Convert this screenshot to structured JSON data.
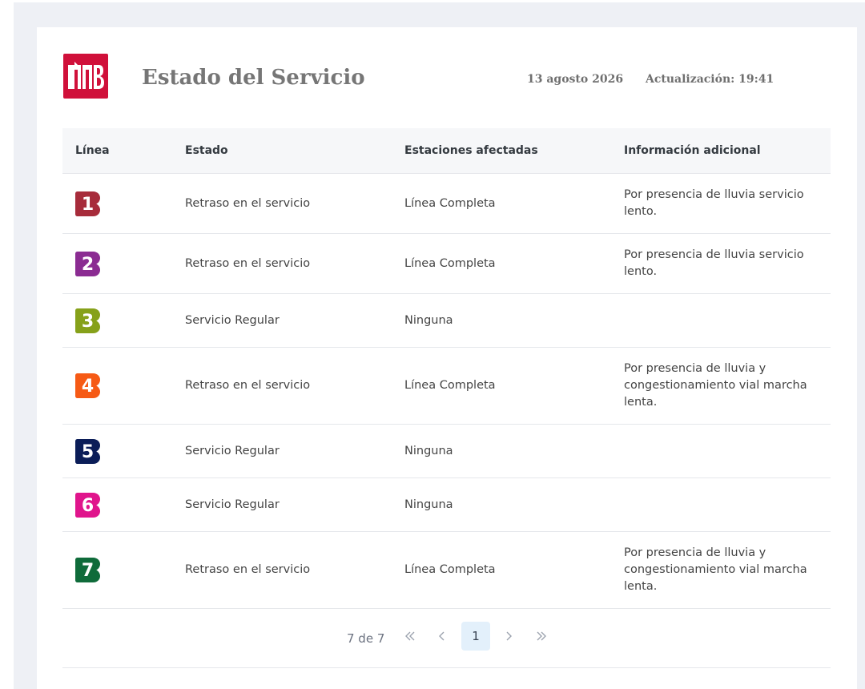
{
  "header": {
    "title": "Estado del Servicio",
    "date": "13 agosto 2026",
    "update": "Actualización: 19:41",
    "logo_color": "#d0103a"
  },
  "table": {
    "columns": [
      "Línea",
      "Estado",
      "Estaciones afectadas",
      "Información adicional"
    ],
    "rows": [
      {
        "line": "1",
        "color": "#a72c3b",
        "estado": "Retraso en el servicio",
        "estaciones": "Línea Completa",
        "info": "Por presencia de lluvia servicio lento."
      },
      {
        "line": "2",
        "color": "#8b2c92",
        "estado": "Retraso en el servicio",
        "estaciones": "Línea Completa",
        "info": "Por presencia de lluvia servicio lento."
      },
      {
        "line": "3",
        "color": "#86a11a",
        "estado": "Servicio Regular",
        "estaciones": "Ninguna",
        "info": ""
      },
      {
        "line": "4",
        "color": "#f65a15",
        "estado": "Retraso en el servicio",
        "estaciones": "Línea Completa",
        "info": "Por presencia de lluvia y congestionamiento vial marcha lenta."
      },
      {
        "line": "5",
        "color": "#0b1d58",
        "estado": "Servicio Regular",
        "estaciones": "Ninguna",
        "info": ""
      },
      {
        "line": "6",
        "color": "#e0158c",
        "estado": "Servicio Regular",
        "estaciones": "Ninguna",
        "info": ""
      },
      {
        "line": "7",
        "color": "#0f6b3a",
        "estado": "Retraso en el servicio",
        "estaciones": "Línea Completa",
        "info": "Por presencia de lluvia y congestionamiento vial marcha lenta."
      }
    ]
  },
  "pagination": {
    "summary": "7 de 7",
    "current_page": "1",
    "icons": [
      "first-page-icon",
      "previous-page-icon",
      "next-page-icon",
      "last-page-icon"
    ]
  }
}
